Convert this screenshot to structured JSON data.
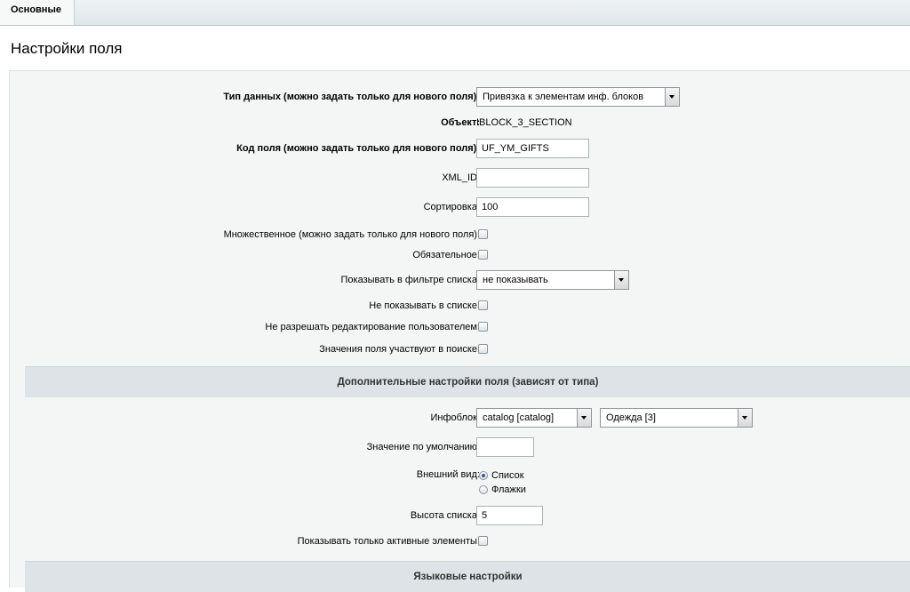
{
  "tabs": [
    {
      "label": "Основные"
    }
  ],
  "page_title": "Настройки поля",
  "fields": {
    "data_type": {
      "label": "Тип данных (можно задать только для нового поля):",
      "value": "Привязка к элементам инф. блоков"
    },
    "object": {
      "label": "Объект:",
      "value": "IBLOCK_3_SECTION"
    },
    "field_code": {
      "label": "Код поля (можно задать только для нового поля):",
      "value": "UF_YM_GIFTS"
    },
    "xml_id": {
      "label": "XML_ID:",
      "value": ""
    },
    "sort": {
      "label": "Сортировка:",
      "value": "100"
    },
    "multiple": {
      "label": "Множественное (можно задать только для нового поля):",
      "checked": false
    },
    "mandatory": {
      "label": "Обязательное:",
      "checked": false
    },
    "show_filter": {
      "label": "Показывать в фильтре списка:",
      "value": "не показывать"
    },
    "hide_in_list": {
      "label": "Не показывать в списке:",
      "checked": false
    },
    "no_user_edit": {
      "label": "Не разрешать редактирование пользователем:",
      "checked": false
    },
    "searchable": {
      "label": "Значения поля участвуют в поиске:",
      "checked": false
    }
  },
  "extra_section": {
    "title": "Дополнительные настройки поля (зависят от типа)",
    "iblock": {
      "label": "Инфоблок:",
      "type_value": "catalog [catalog]",
      "block_value": "Одежда [3]"
    },
    "default_value": {
      "label": "Значение по умолчанию:",
      "value": ""
    },
    "appearance": {
      "label": "Внешний вид:",
      "options": [
        "Список",
        "Флажки"
      ],
      "selected": "Список"
    },
    "list_height": {
      "label": "Высота списка:",
      "value": "5"
    },
    "active_only": {
      "label": "Показывать только активные элементы:",
      "checked": false
    }
  },
  "lang_section": {
    "title": "Языковые настройки"
  }
}
